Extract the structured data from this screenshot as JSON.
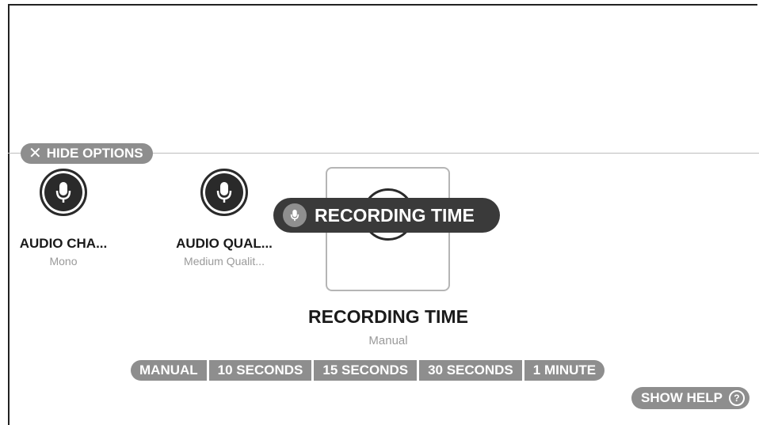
{
  "hide_options": {
    "label": "HIDE OPTIONS"
  },
  "options": [
    {
      "title": "AUDIO CHA...",
      "value": "Mono"
    },
    {
      "title": "AUDIO QUAL...",
      "value": "Medium Qualit..."
    }
  ],
  "tooltip": {
    "label": "RECORDING TIME"
  },
  "selected": {
    "title": "RECORDING TIME",
    "value": "Manual"
  },
  "segments": [
    "MANUAL",
    "10 SECONDS",
    "15 SECONDS",
    "30 SECONDS",
    "1 MINUTE"
  ],
  "show_help": {
    "label": "SHOW HELP",
    "icon_glyph": "?"
  },
  "icons": {
    "option_icon": "microphone-icon",
    "hide_icon": "close-icon",
    "help_icon": "help-icon"
  }
}
